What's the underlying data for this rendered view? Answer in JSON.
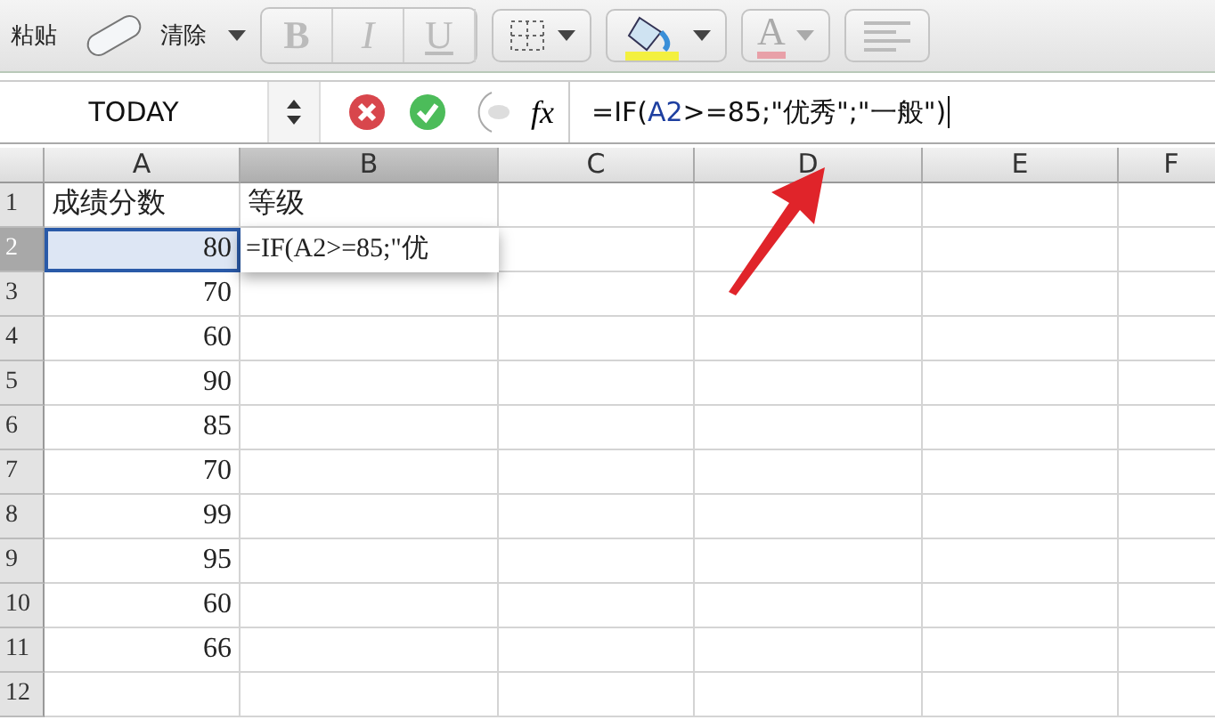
{
  "toolbar": {
    "paste_label": "粘贴",
    "clear_label": "清除",
    "style_buttons": [
      "B",
      "I",
      "U"
    ],
    "font_color_letter": "A"
  },
  "formula_bar": {
    "name_box": "TODAY",
    "function_label": "fx",
    "formula": [
      {
        "text": "=IF(",
        "kind": "plain"
      },
      {
        "text": "A2",
        "kind": "ref"
      },
      {
        "text": ">=85;\"优秀\";\"一般\")",
        "kind": "plain"
      }
    ]
  },
  "sheet": {
    "columns": [
      {
        "label": "A",
        "selected": false
      },
      {
        "label": "B",
        "selected": true
      },
      {
        "label": "C",
        "selected": false
      },
      {
        "label": "D",
        "selected": false
      },
      {
        "label": "E",
        "selected": false
      },
      {
        "label": "F",
        "selected": false
      }
    ],
    "rows": [
      {
        "label": "1",
        "selected": false,
        "cells": [
          "成绩分数",
          "等级"
        ]
      },
      {
        "label": "2",
        "selected": true,
        "cells": [
          "80"
        ]
      },
      {
        "label": "3",
        "selected": false,
        "cells": [
          "70"
        ]
      },
      {
        "label": "4",
        "selected": false,
        "cells": [
          "60"
        ]
      },
      {
        "label": "5",
        "selected": false,
        "cells": [
          "90"
        ]
      },
      {
        "label": "6",
        "selected": false,
        "cells": [
          "85"
        ]
      },
      {
        "label": "7",
        "selected": false,
        "cells": [
          "70"
        ]
      },
      {
        "label": "8",
        "selected": false,
        "cells": [
          "99"
        ]
      },
      {
        "label": "9",
        "selected": false,
        "cells": [
          "95"
        ]
      },
      {
        "label": "10",
        "selected": false,
        "cells": [
          "60"
        ]
      },
      {
        "label": "11",
        "selected": false,
        "cells": [
          "66"
        ]
      },
      {
        "label": "12",
        "selected": false,
        "cells": []
      }
    ],
    "cell_editor": "=IF(A2>=85;\"优"
  }
}
